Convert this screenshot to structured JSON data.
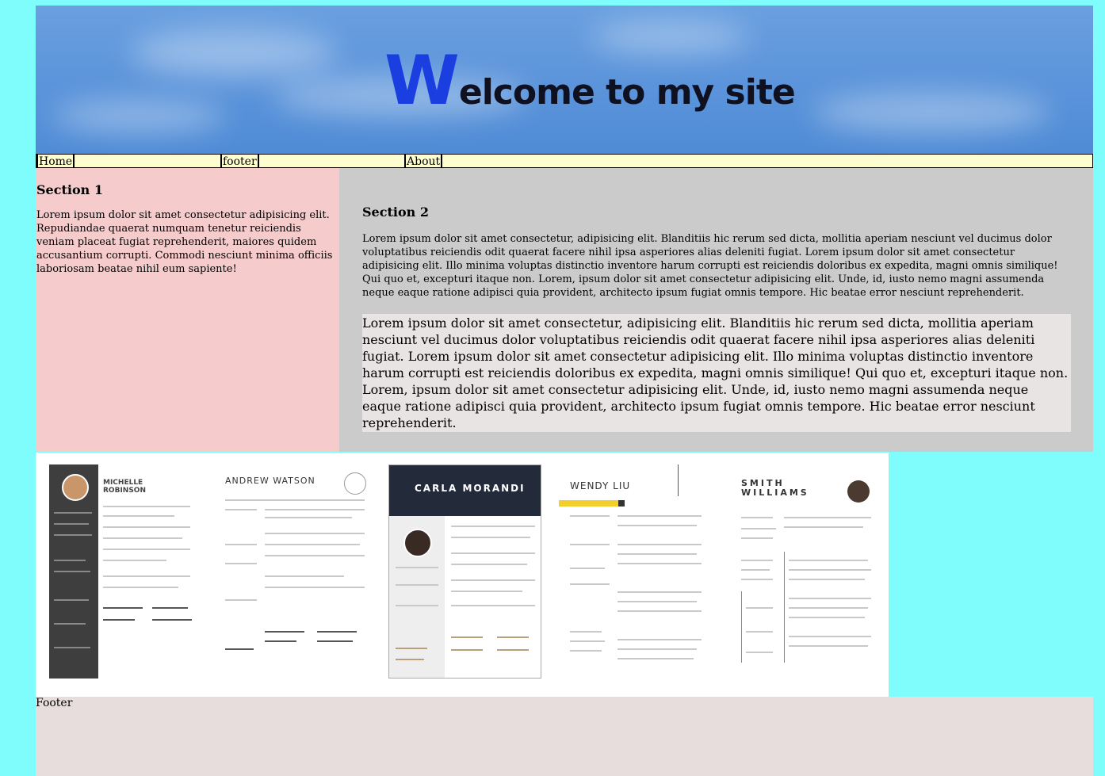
{
  "banner": {
    "title_cap": "W",
    "title_rest": "elcome to my site"
  },
  "nav": {
    "items": [
      "Home",
      "footer",
      "About"
    ]
  },
  "section1": {
    "heading": "Section 1",
    "text": "Lorem ipsum dolor sit amet consectetur adipisicing elit. Repudiandae quaerat numquam tenetur reiciendis veniam placeat fugiat reprehenderit, maiores quidem accusantium corrupti. Commodi nesciunt minima officiis laboriosam beatae nihil eum sapiente!"
  },
  "section2": {
    "heading": "Section 2",
    "text_small": "Lorem ipsum dolor sit amet consectetur, adipisicing elit. Blanditiis hic rerum sed dicta, mollitia aperiam nesciunt vel ducimus dolor voluptatibus reiciendis odit quaerat facere nihil ipsa asperiores alias deleniti fugiat. Lorem ipsum dolor sit amet consectetur adipisicing elit. Illo minima voluptas distinctio inventore harum corrupti est reiciendis doloribus ex expedita, magni omnis similique! Qui quo et, excepturi itaque non. Lorem, ipsum dolor sit amet consectetur adipisicing elit. Unde, id, iusto nemo magni assumenda neque eaque ratione adipisci quia provident, architecto ipsum fugiat omnis tempore. Hic beatae error nesciunt reprehenderit.",
    "text_big": "Lorem ipsum dolor sit amet consectetur, adipisicing elit. Blanditiis hic rerum sed dicta, mollitia aperiam nesciunt vel ducimus dolor voluptatibus reiciendis odit quaerat facere nihil ipsa asperiores alias deleniti fugiat. Lorem ipsum dolor sit amet consectetur adipisicing elit. Illo minima voluptas distinctio inventore harum corrupti est reiciendis doloribus ex expedita, magni omnis similique! Qui quo et, excepturi itaque non. Lorem, ipsum dolor sit amet consectetur adipisicing elit. Unde, id, iusto nemo magni assumenda neque eaque ratione adipisci quia provident, architecto ipsum fugiat omnis tempore. Hic beatae error nesciunt reprehenderit."
  },
  "gallery": {
    "resumes": [
      {
        "name": "MICHELLE\nROBINSON"
      },
      {
        "name": "ANDREW WATSON"
      },
      {
        "name": "CARLA MORANDI"
      },
      {
        "name": "WENDY LIU"
      },
      {
        "name": "SMITH\nWILLIAMS"
      }
    ]
  },
  "footer": {
    "text": "Footer"
  },
  "colors": {
    "page_bg": "#7ffcfc",
    "nav_bg": "#fdfdd0",
    "section1_bg": "#f6cbcb",
    "section2_bg": "#cbcbcb",
    "footer_bg": "#e8dddd",
    "title_cap": "#1a3ee0"
  }
}
